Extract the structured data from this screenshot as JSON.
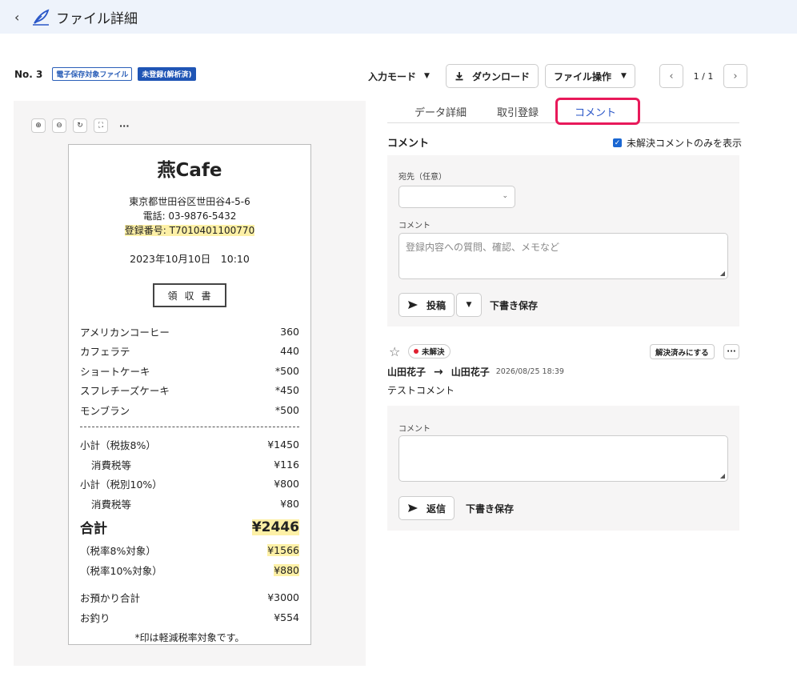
{
  "header": {
    "title": "ファイル詳細",
    "back_icon": "chevron-left-icon",
    "logo_icon": "feather-pen-icon"
  },
  "info": {
    "number": "No. 3",
    "badge_type": "電子保存対象ファイル",
    "badge_status": "未登録(解析済)"
  },
  "toolbar": {
    "mode": "入力モード",
    "download": "ダウンロード",
    "file_ops": "ファイル操作"
  },
  "pager": {
    "label": "1 / 1"
  },
  "viewer": {
    "tools": [
      "zoom-in-icon",
      "zoom-out-icon",
      "rotate-icon",
      "fullscreen-icon"
    ],
    "more": "···"
  },
  "receipt": {
    "shop": "燕Cafe",
    "address": "東京都世田谷区世田谷4-5-6",
    "phone": "電話: 03-9876-5432",
    "reg": "登録番号: T7010401100770",
    "datetime": "2023年10月10日　10:10",
    "doc_title": "領収書",
    "items": [
      {
        "name": "アメリカンコーヒー",
        "price": "360"
      },
      {
        "name": "カフェラテ",
        "price": "440"
      },
      {
        "name": "ショートケーキ",
        "price": "*500"
      },
      {
        "name": "スフレチーズケーキ",
        "price": "*450"
      },
      {
        "name": "モンブラン",
        "price": "*500"
      }
    ],
    "subtotal8_label": "小計（税抜8%）",
    "subtotal8": "¥1450",
    "tax8_label": "消費税等",
    "tax8": "¥116",
    "subtotal10_label": "小計（税別10%）",
    "subtotal10": "¥800",
    "tax10_label": "消費税等",
    "tax10": "¥80",
    "total_label": "合計",
    "total": "¥2446",
    "target8_label": "（税率8%対象）",
    "target8": "¥1566",
    "target10_label": "（税率10%対象）",
    "target10": "¥880",
    "paid_label": "お預かり合計",
    "paid": "¥3000",
    "change_label": "お釣り",
    "change": "¥554",
    "note": "*印は軽減税率対象です。"
  },
  "tabs": [
    {
      "label": "データ詳細"
    },
    {
      "label": "取引登録"
    },
    {
      "label": "コメント"
    }
  ],
  "comments": {
    "title": "コメント",
    "filter_label": "未解決コメントのみを表示",
    "recipient_label": "宛先（任意）",
    "comment_label": "コメント",
    "comment_placeholder": "登録内容への質問、確認、メモなど",
    "post": "投稿",
    "draft": "下書き保存",
    "item": {
      "status": "未解決",
      "resolve": "解決済みにする",
      "more": "···",
      "from": "山田花子",
      "to": "山田花子",
      "timestamp": "2026/08/25 18:39",
      "body": "テストコメント"
    },
    "reply_label": "コメント",
    "reply": "返信",
    "reply_draft": "下書き保存"
  }
}
